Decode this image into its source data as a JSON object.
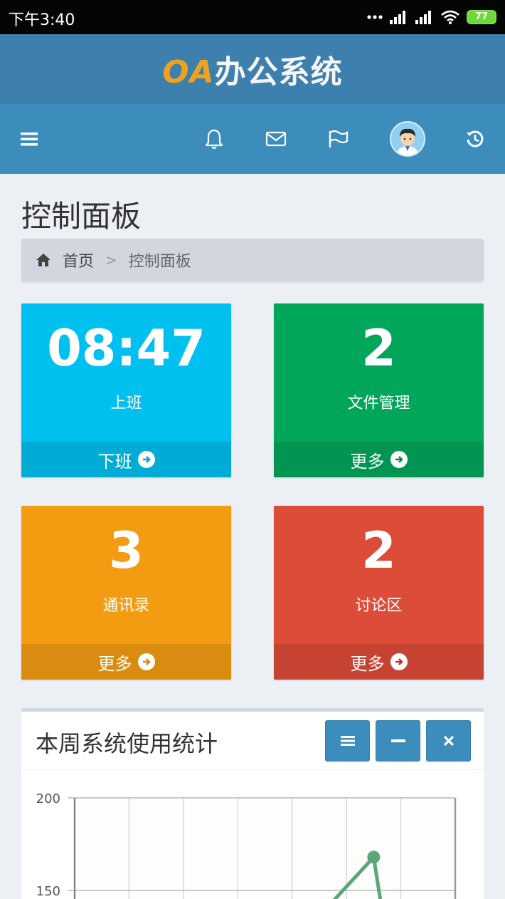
{
  "status_bar": {
    "time": "下午3:40",
    "battery": "77"
  },
  "app": {
    "logo_oa": "OA",
    "logo_text": "办公系统"
  },
  "page": {
    "title": "控制面板"
  },
  "breadcrumb": {
    "home": "首页",
    "separator": ">",
    "current": "控制面板"
  },
  "tiles": [
    {
      "value": "08:47",
      "label": "上班",
      "footer": "下班",
      "color": "#00c0ef"
    },
    {
      "value": "2",
      "label": "文件管理",
      "footer": "更多",
      "color": "#00a65a"
    },
    {
      "value": "3",
      "label": "通讯录",
      "footer": "更多",
      "color": "#f39c12"
    },
    {
      "value": "2",
      "label": "讨论区",
      "footer": "更多",
      "color": "#dd4b39"
    }
  ],
  "chart_box": {
    "title": "本周系统使用统计"
  },
  "chart_data": {
    "type": "line",
    "title": "",
    "xlabel": "",
    "ylabel": "",
    "ylim": [
      150,
      200
    ],
    "yticks": [
      200,
      150
    ],
    "x_count": 7,
    "series": [
      {
        "values": [
          null,
          null,
          null,
          null,
          null,
          168,
          null
        ],
        "color": "#5aa679"
      }
    ],
    "grid": true
  }
}
